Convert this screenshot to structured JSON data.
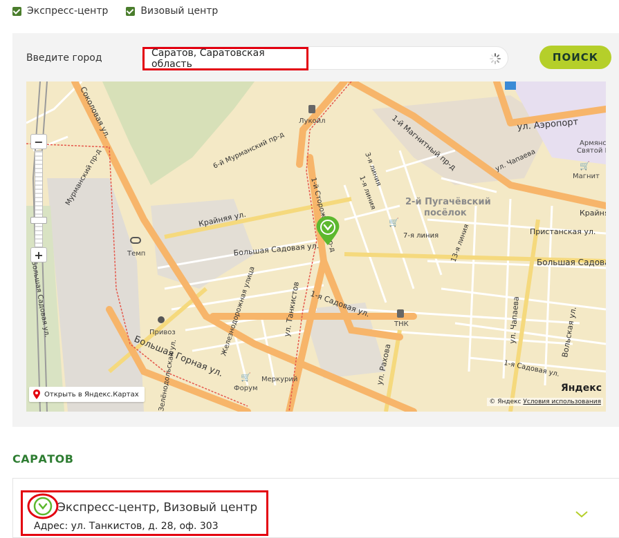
{
  "filters": [
    {
      "label": "Экспресс-центр",
      "checked": true
    },
    {
      "label": "Визовый центр",
      "checked": true
    }
  ],
  "search": {
    "label": "Введите город",
    "value": "Саратов, Саратовская область",
    "button_label": "ПОИСК"
  },
  "map": {
    "open_link": "Открыть в Яндекс.Картах",
    "copyright": "© Яндекс",
    "terms": "Условия использования",
    "brand": "Яндекс",
    "labels": {
      "sokolovaya": "Соколовая ул.",
      "murmansky": "6-й Мурманский пр-д",
      "murmansky_pd": "Мурманский пр-д",
      "kraynyaya": "Крайняя ул.",
      "b_sadovaya": "Большая Садовая ул.",
      "b_sadovaya_left": "Большая Садовая ул.",
      "sadovaya1": "1-я Садовая ул.",
      "tankistov": "ул. Танкистов",
      "storozh": "1-й Сторожевой пр-д",
      "liniya1": "1-я линия",
      "liniya3": "3-я линия",
      "liniya7": "7-я линия",
      "liniya13": "13-я линия",
      "pugach": "2-й Пугачёвский",
      "poselok": "посёлок",
      "magnitny": "1-й Магнитный пр-д",
      "aeroport": "ул. Аэропорт",
      "chapaeva": "ул. Чапаева",
      "chapaeva2": "ул. Чапаева",
      "pristanskaya": "Пристанская ул.",
      "bsadovaya_right": "Большая Садова",
      "kraynyaya2": "Крайня",
      "volskaya": "Вольская ул.",
      "sadovaya1b": "1-я Садовая ул.",
      "zhelez": "Железнодорожная улица",
      "zelenodol": "Зелёнодольская ул.",
      "b_gornaya": "Большая Горная ул.",
      "rakhova": "ул. Рахова",
      "lukoil": "Лукойл",
      "temp": "Темп",
      "privoz": "Привоз",
      "merkuriy": "Меркурий",
      "forum": "Форум",
      "tnk": "ТНК",
      "magnit": "Магнит",
      "armyan": "Армянск",
      "svyatoi": "Святой Б"
    }
  },
  "result": {
    "city": "САРАТОВ",
    "title": "Экспресс-центр, Визовый центр",
    "address": "Адрес: ул. Танкистов, д. 28, оф. 303"
  },
  "colors": {
    "accent": "#b5cf2a",
    "heading": "#2e7d32",
    "highlight": "#e3000f",
    "marker": "#5cb82e"
  }
}
